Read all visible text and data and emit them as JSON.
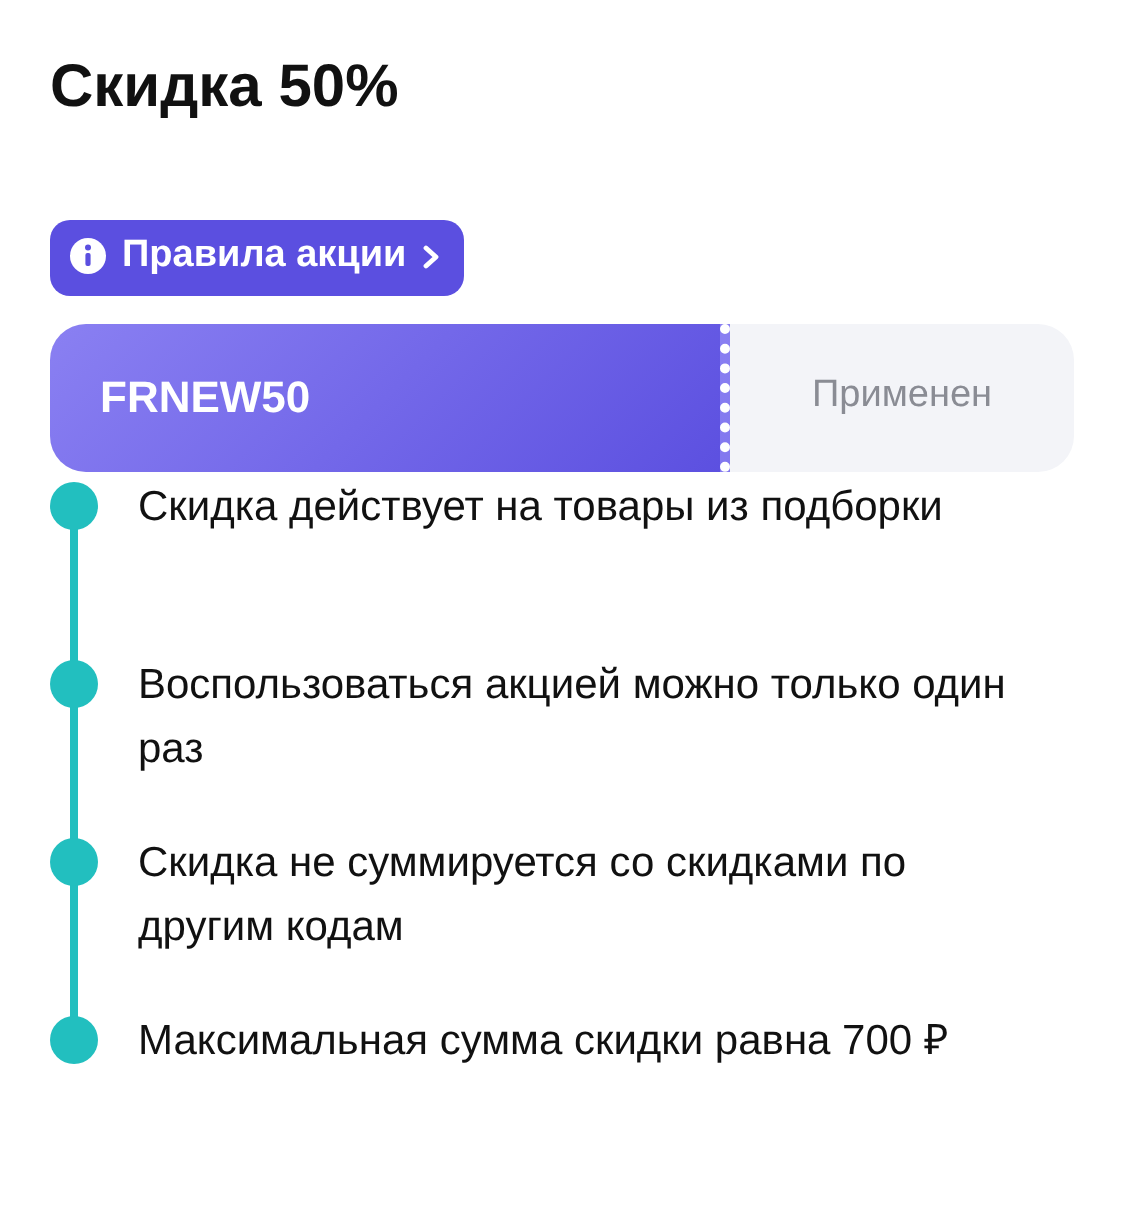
{
  "title": "Скидка 50%",
  "rules_button": {
    "label": "Правила акции"
  },
  "coupon": {
    "code": "FRNEW50",
    "status": "Применен"
  },
  "rules": [
    {
      "text": "Скидка действует на товары из подборки"
    },
    {
      "text": "Воспользоваться акцией можно только один раз"
    },
    {
      "text": "Скидка не суммируется со скидками по другим кодам"
    },
    {
      "text": "Максимальная сумма скидки равна 700 ₽"
    }
  ]
}
